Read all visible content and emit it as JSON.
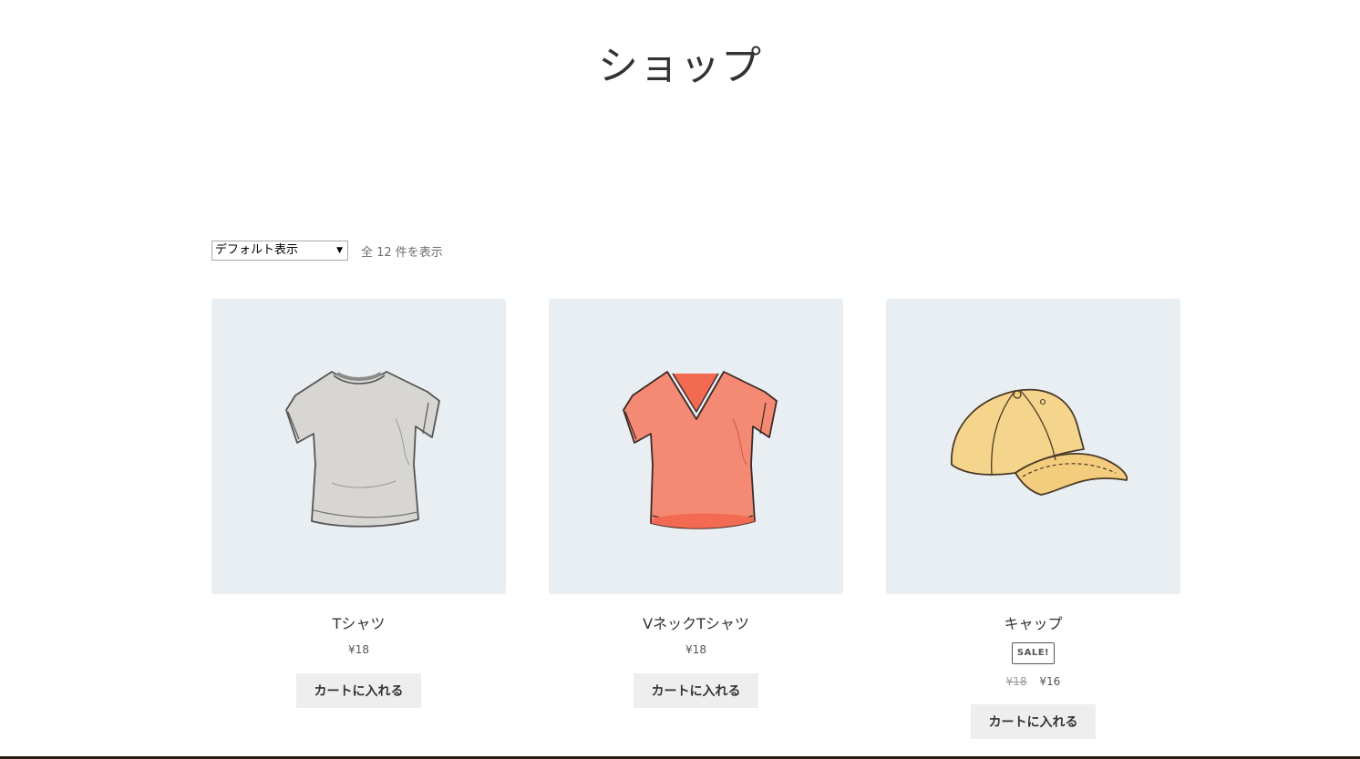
{
  "page": {
    "title": "ショップ"
  },
  "toolbar": {
    "sort_selected": "デフォルト表示",
    "result_count": "全 12 件を表示"
  },
  "products": [
    {
      "name": "Tシャツ",
      "image_icon": "tshirt-icon",
      "price": "¥18",
      "button_label": "カートに入れる"
    },
    {
      "name": "VネックTシャツ",
      "image_icon": "vneck-tshirt-icon",
      "price": "¥18",
      "button_label": "カートに入れる"
    },
    {
      "name": "キャップ",
      "image_icon": "cap-icon",
      "sale_badge": "SALE!",
      "old_price": "¥18",
      "price": "¥16",
      "button_label": "カートに入れる"
    }
  ],
  "colors": {
    "thumb_background": "#e9eef2",
    "tshirt_fill": "#d8d6d3",
    "vneck_fill": "#f48a73",
    "cap_fill": "#f5d48c",
    "button_background": "#eeeeee",
    "footer_bar": "#2c1a12"
  }
}
